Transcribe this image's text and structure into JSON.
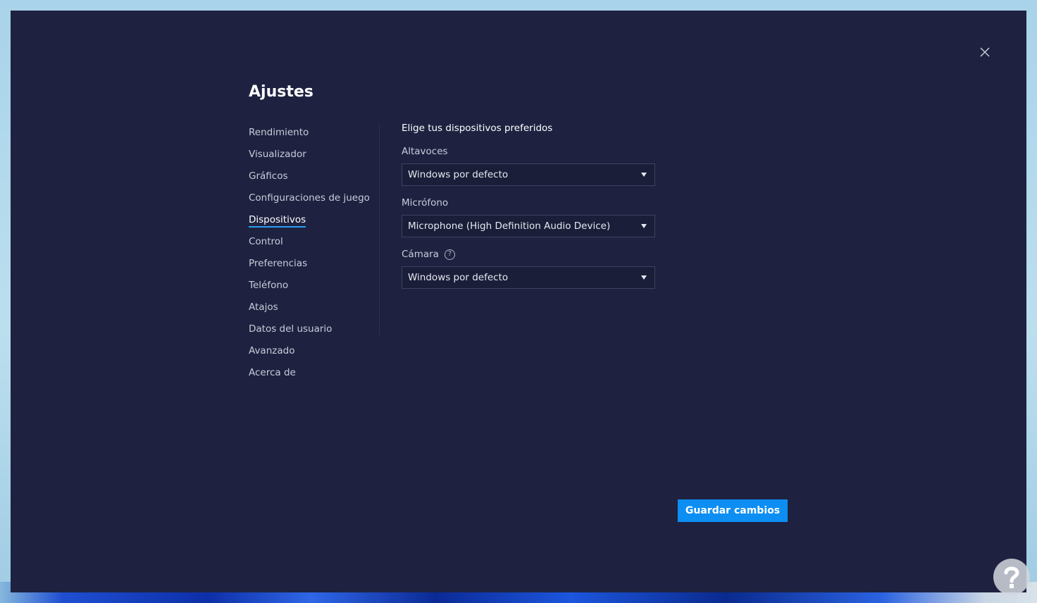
{
  "window": {
    "title": "Ajustes",
    "close_icon": "close-icon"
  },
  "sidebar": {
    "items": [
      {
        "label": "Rendimiento",
        "active": false
      },
      {
        "label": "Visualizador",
        "active": false
      },
      {
        "label": "Gráficos",
        "active": false
      },
      {
        "label": "Configuraciones de juego",
        "active": false
      },
      {
        "label": "Dispositivos",
        "active": true
      },
      {
        "label": "Control",
        "active": false
      },
      {
        "label": "Preferencias",
        "active": false
      },
      {
        "label": "Teléfono",
        "active": false
      },
      {
        "label": "Atajos",
        "active": false
      },
      {
        "label": "Datos del usuario",
        "active": false
      },
      {
        "label": "Avanzado",
        "active": false
      },
      {
        "label": "Acerca de",
        "active": false
      }
    ]
  },
  "devices": {
    "heading": "Elige tus dispositivos preferidos",
    "speakers": {
      "label": "Altavoces",
      "value": "Windows por defecto"
    },
    "microphone": {
      "label": "Micrófono",
      "value": "Microphone (High Definition Audio Device)"
    },
    "camera": {
      "label": "Cámara",
      "help_icon": "question-mark-icon",
      "help_glyph": "?",
      "value": "Windows por defecto"
    }
  },
  "footer": {
    "save_label": "Guardar cambios"
  },
  "colors": {
    "window_background": "#1e2240",
    "accent": "#0d8ef3",
    "active_underline": "#2d9cf0"
  }
}
